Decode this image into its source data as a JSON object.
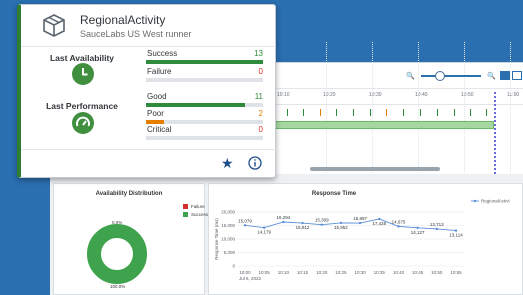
{
  "popover": {
    "title": "RegionalActivity",
    "subtitle": "SauceLabs US West runner",
    "availability": {
      "heading": "Last Availability",
      "metrics": [
        {
          "label": "Success",
          "value": "13",
          "fraction": 1.0,
          "color": "#2e8b3c"
        },
        {
          "label": "Failure",
          "value": "0",
          "fraction": 0.0,
          "color": "#d32f2f"
        }
      ]
    },
    "performance": {
      "heading": "Last Performance",
      "metrics": [
        {
          "label": "Good",
          "value": "11",
          "fraction": 0.85,
          "color": "#2e8b3c"
        },
        {
          "label": "Poor",
          "value": "2",
          "fraction": 0.15,
          "color": "#e67e00"
        },
        {
          "label": "Critical",
          "value": "0",
          "fraction": 0.0,
          "color": "#d32f2f"
        }
      ]
    },
    "colors": {
      "accent": "#2e7d32",
      "action": "#1d4e89"
    }
  },
  "timeline": {
    "ticks": [
      "10:10",
      "10:20",
      "10:30",
      "10:40",
      "10:50",
      "11:00"
    ]
  },
  "availability_chart": {
    "title": "Availability Distribution",
    "legend": [
      {
        "label": "Failure",
        "color": "#d32f2f"
      },
      {
        "label": "Success",
        "color": "#3fa34d"
      }
    ],
    "labels": {
      "failure": "0.0%",
      "success": "100.0%"
    }
  },
  "chart_data": {
    "type": "line",
    "title": "Response Time",
    "ylabel": "Response Time (ms)",
    "x": [
      "10:00",
      "10:05",
      "10:10",
      "10:15",
      "10:20",
      "10:25",
      "10:30",
      "10:35",
      "10:40",
      "10:45",
      "10:50",
      "10:55"
    ],
    "date_label": "Jul 6, 2022",
    "ylim": [
      0,
      20000
    ],
    "yticks": [
      "20,000",
      "15,000",
      "10,000",
      "5,000",
      "0"
    ],
    "series": [
      {
        "name": "RegionalActivi",
        "color": "#5b8fd6",
        "values": [
          15079,
          14179,
          16294,
          15912,
          15309,
          15952,
          15897,
          17428,
          14675,
          14127,
          13713,
          13114
        ],
        "labels": [
          "15,079",
          "14,179",
          "16,294",
          "15,912",
          "15,309",
          "15,952",
          "15,897",
          "17,428",
          "14,675",
          "14,127",
          "13,713",
          "13,114"
        ]
      }
    ]
  }
}
